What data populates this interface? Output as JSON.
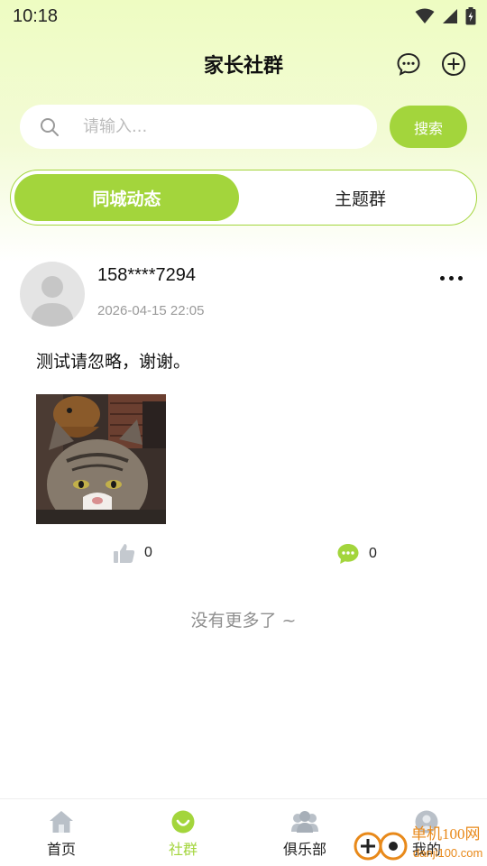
{
  "status_bar": {
    "time": "10:18"
  },
  "header": {
    "title": "家长社群"
  },
  "search": {
    "placeholder": "请输入...",
    "button_label": "搜索"
  },
  "tabs": [
    {
      "label": "同城动态",
      "active": true
    },
    {
      "label": "主题群",
      "active": false
    }
  ],
  "post": {
    "username": "158****7294",
    "time": "2026-04-15 22:05",
    "text": "测试请忽略，谢谢。",
    "likes": "0",
    "comments": "0"
  },
  "feed_end_text": "没有更多了 ~",
  "bottom_nav": [
    {
      "label": "首页",
      "icon": "home-icon",
      "active": false
    },
    {
      "label": "社群",
      "icon": "community-icon",
      "active": true
    },
    {
      "label": "俱乐部",
      "icon": "club-icon",
      "active": false
    },
    {
      "label": "我的",
      "icon": "profile-icon",
      "active": false
    }
  ],
  "watermark": {
    "brand": "单机100网",
    "url": "danji100.com"
  },
  "colors": {
    "accent": "#a3d53c",
    "header_bg": "#eefcc2"
  }
}
